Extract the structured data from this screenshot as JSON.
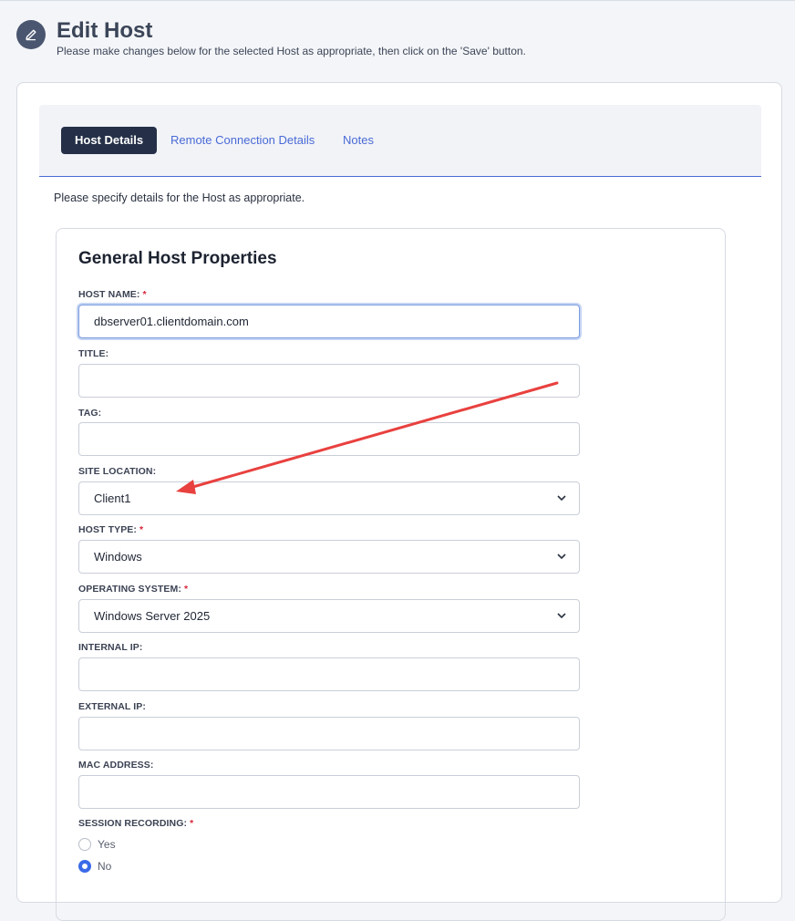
{
  "header": {
    "title": "Edit Host",
    "subtitle": "Please make changes below for the selected Host as appropriate, then click on the 'Save' button.",
    "icon": "pencil-icon"
  },
  "tabs": [
    {
      "label": "Host Details",
      "active": true
    },
    {
      "label": "Remote Connection Details",
      "active": false
    },
    {
      "label": "Notes",
      "active": false
    }
  ],
  "intro_text": "Please specify details for the Host as appropriate.",
  "section": {
    "title": "General Host Properties",
    "required_marker": "*",
    "fields": {
      "host_name": {
        "label": "HOST NAME:",
        "value": "dbserver01.clientdomain.com"
      },
      "title": {
        "label": "TITLE:",
        "value": ""
      },
      "tag": {
        "label": "TAG:",
        "value": ""
      },
      "site_location": {
        "label": "SITE LOCATION:",
        "value": "Client1"
      },
      "host_type": {
        "label": "HOST TYPE:",
        "value": "Windows"
      },
      "operating_system": {
        "label": "OPERATING SYSTEM:",
        "value": "Windows Server 2025"
      },
      "internal_ip": {
        "label": "INTERNAL IP:",
        "value": ""
      },
      "external_ip": {
        "label": "EXTERNAL IP:",
        "value": ""
      },
      "mac_address": {
        "label": "MAC ADDRESS:",
        "value": ""
      },
      "session_recording": {
        "label": "SESSION RECORDING:",
        "options": [
          {
            "label": "Yes",
            "checked": false
          },
          {
            "label": "No",
            "checked": true
          }
        ]
      }
    }
  },
  "colors": {
    "accent": "#4a6ad6",
    "active_tab": "#253048",
    "required": "#d8263a",
    "radio_checked": "#3b6ae8",
    "annotation_arrow": "#e8413f"
  }
}
